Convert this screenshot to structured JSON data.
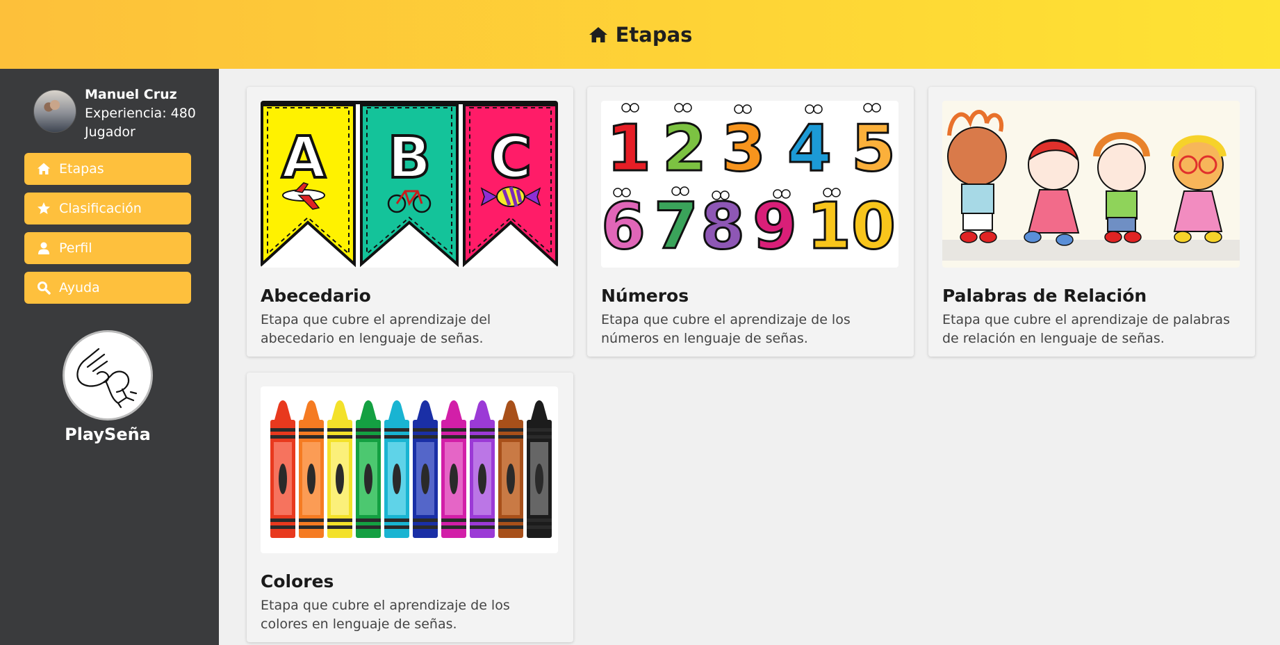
{
  "header": {
    "title": "Etapas",
    "icon": "home-icon"
  },
  "user": {
    "name": "Manuel Cruz",
    "experience": "Experiencia: 480",
    "role": "Jugador"
  },
  "nav": [
    {
      "label": "Etapas",
      "icon": "home-icon"
    },
    {
      "label": "Clasificación",
      "icon": "star-icon"
    },
    {
      "label": "Perfil",
      "icon": "user-icon"
    },
    {
      "label": "Ayuda",
      "icon": "search-icon"
    }
  ],
  "brand": {
    "name": "PlaySeña"
  },
  "stages": [
    {
      "title": "Abecedario",
      "description": "Etapa que cubre el aprendizaje del abecedario en lenguaje de señas.",
      "image": "abc-banner-image",
      "letters": [
        "A",
        "B",
        "C"
      ]
    },
    {
      "title": "Números",
      "description": "Etapa que cubre el aprendizaje de los números en lenguaje de señas.",
      "image": "numbers-image",
      "numerals": [
        "1",
        "2",
        "3",
        "4",
        "5",
        "6",
        "7",
        "8",
        "9",
        "10"
      ]
    },
    {
      "title": "Palabras de Relación",
      "description": "Etapa que cubre el aprendizaje de palabras de relación en lenguaje de señas.",
      "image": "kids-holding-hands-image"
    },
    {
      "title": "Colores",
      "description": "Etapa que cubre el aprendizaje de los colores en lenguaje de señas.",
      "image": "crayons-image"
    }
  ],
  "colors": {
    "header_start": "#fdc03a",
    "header_end": "#fee333",
    "sidebar": "#3a3b3d",
    "nav_button": "#fec03d"
  }
}
